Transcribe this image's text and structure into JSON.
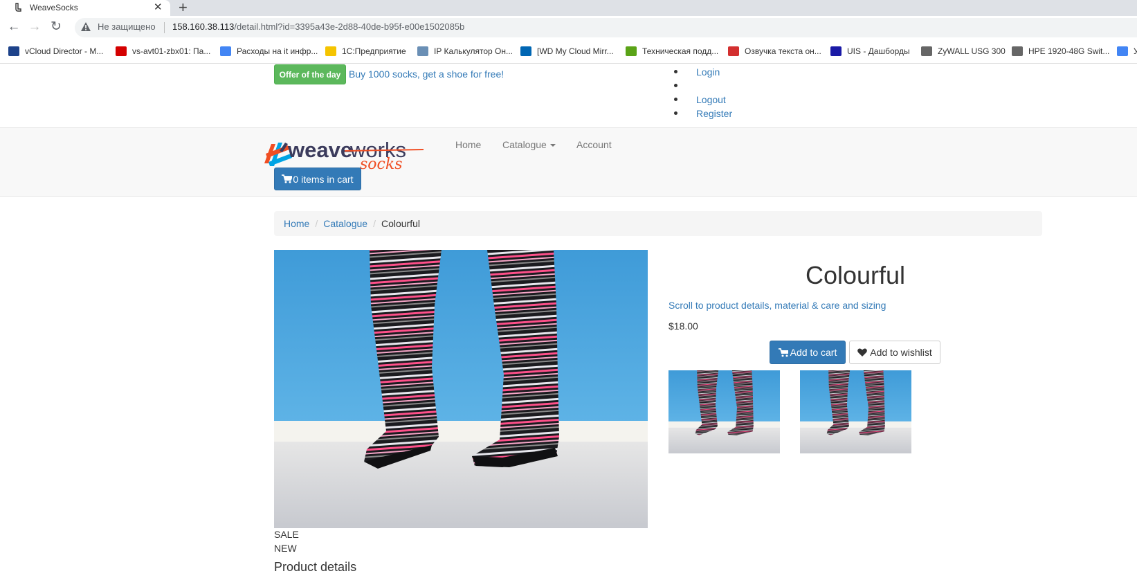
{
  "browser": {
    "tab_title": "WeaveSocks",
    "new_tab": "+",
    "close": "✕",
    "security_label": "Не защищено",
    "url_host": "158.160.38.113",
    "url_path": "/detail.html?id=3395a43e-2d88-40de-b95f-e00e1502085b",
    "bookmarks": [
      {
        "label": "vCloud Director - M...",
        "icon": "vmware-icon",
        "color": "#1d428a"
      },
      {
        "label": "vs-avt01-zbx01: Па...",
        "icon": "zabbix-icon",
        "color": "#d40000"
      },
      {
        "label": "Расходы на it инфр...",
        "icon": "google-icon",
        "color": "#4285f4"
      },
      {
        "label": "1С:Предприятие",
        "icon": "1c-icon",
        "color": "#f5c400"
      },
      {
        "label": "IP Калькулятор Он...",
        "icon": "ip-calc-icon",
        "color": "#6a8fb5"
      },
      {
        "label": "[WD My Cloud Mirr...",
        "icon": "wd-icon",
        "color": "#0066b3"
      },
      {
        "label": "Техническая подд...",
        "icon": "it-icon",
        "color": "#5aa317"
      },
      {
        "label": "Озвучка текста он...",
        "icon": "voice-icon",
        "color": "#d32f2f"
      },
      {
        "label": "UIS - Дашборды",
        "icon": "uis-icon",
        "color": "#1a1aa6"
      },
      {
        "label": "ZyWALL USG 300",
        "icon": "globe-icon",
        "color": "#666666"
      },
      {
        "label": "HPE 1920-48G Swit...",
        "icon": "globe-icon",
        "color": "#666666"
      },
      {
        "label": "У",
        "icon": "docs-icon",
        "color": "#4285f4"
      }
    ]
  },
  "top": {
    "offer_label": "Offer of the day",
    "offer_text": "Buy 1000 socks, get a shoe for free!",
    "user_menu": [
      "Login",
      "",
      "Logout",
      "Register"
    ]
  },
  "nav": {
    "logo_main": "weave",
    "logo_accent": "works",
    "logo_sub": "socks",
    "items": [
      "Home",
      "Catalogue",
      "Account"
    ],
    "cart_label": "0 items in cart"
  },
  "breadcrumb": [
    "Home",
    "Catalogue",
    "Colourful"
  ],
  "product": {
    "name": "Colourful",
    "goto_text": "Scroll to product details, material & care and sizing",
    "price": "$18.00",
    "add_to_cart": "Add to cart",
    "add_to_wishlist": "Add to wishlist",
    "labels": [
      "SALE",
      "NEW"
    ],
    "details_title": "Product details"
  },
  "colors": {
    "primary": "#337ab7",
    "success": "#5cb85c",
    "logo_orange": "#f04e23",
    "logo_blue": "#00a4e4"
  }
}
